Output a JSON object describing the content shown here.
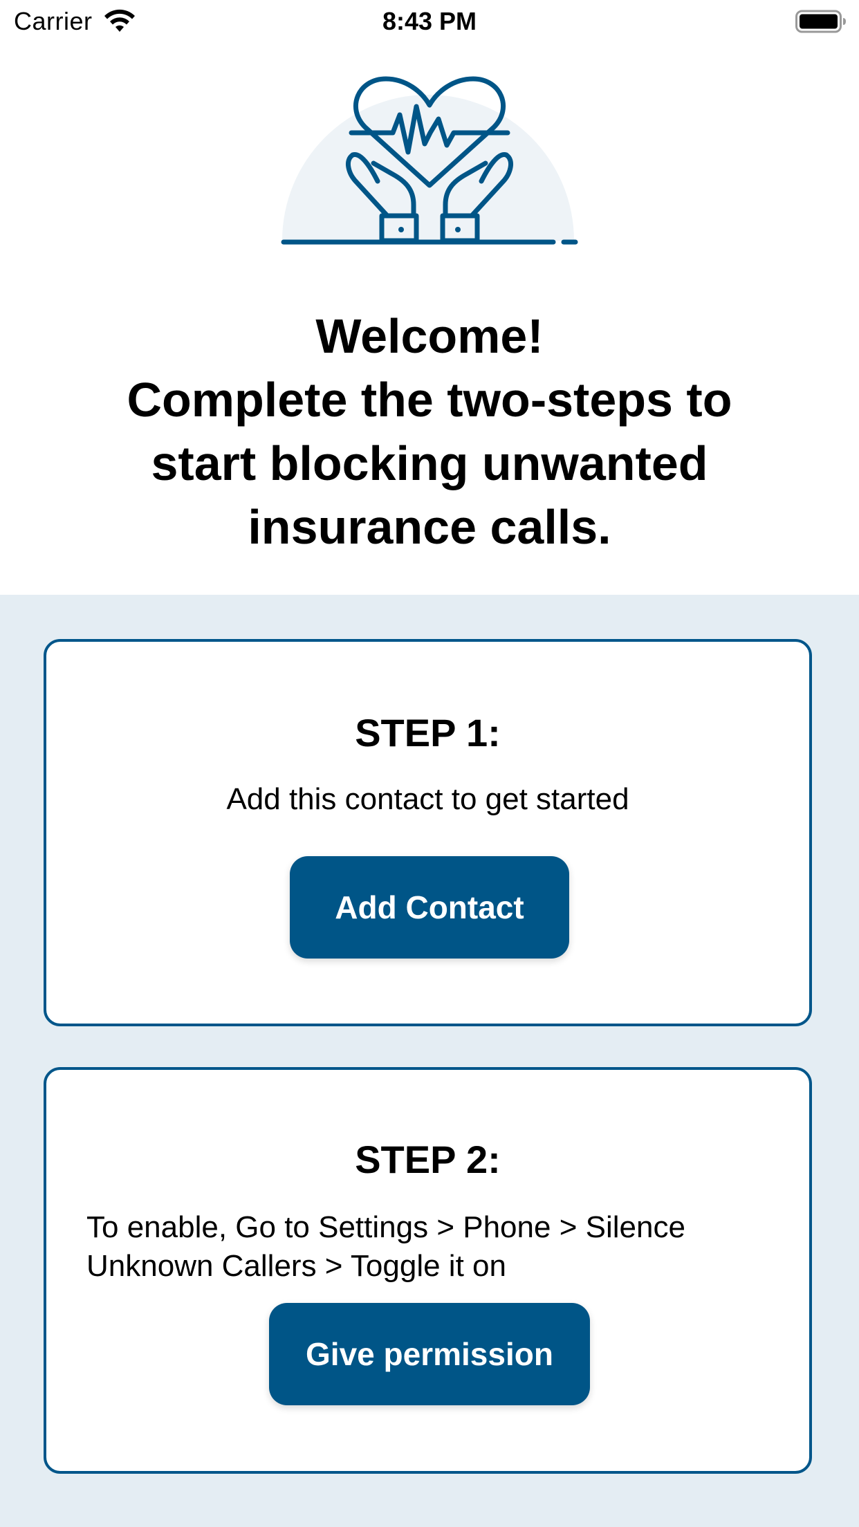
{
  "status_bar": {
    "carrier": "Carrier",
    "time": "8:43 PM"
  },
  "hero": {
    "icon": "heart-pulse-hands-icon",
    "accent_color": "#005587",
    "circle_color": "#eef3f7"
  },
  "headline": {
    "line1": "Welcome!",
    "line2": "Complete the two-steps to",
    "line3": "start blocking unwanted",
    "line4": "insurance calls."
  },
  "steps": [
    {
      "title": "STEP 1:",
      "description": "Add this contact to get started",
      "button_label": "Add Contact"
    },
    {
      "title": "STEP 2:",
      "description": "To enable, Go to Settings > Phone > Silence Unknown Callers > Toggle it on",
      "button_label": "Give permission"
    }
  ],
  "colors": {
    "brand": "#005587",
    "card_border": "#00568a",
    "background_panel": "#e4edf3"
  }
}
